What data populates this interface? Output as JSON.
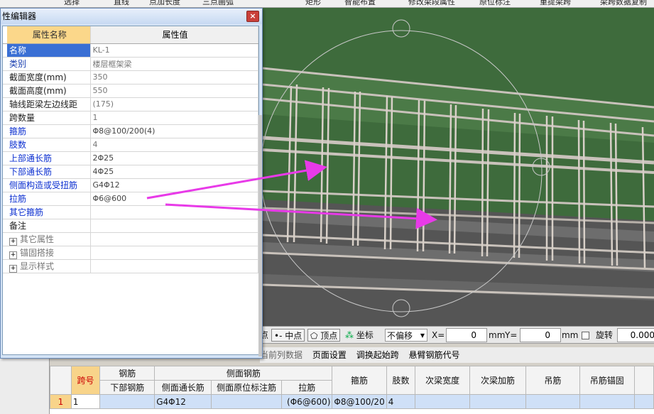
{
  "toolbar": {
    "items": [
      "选择",
      "直线",
      "点加长度",
      "三点画弧",
      "矩形",
      "智能布置",
      "修改梁段属性",
      "原位标注",
      "重提梁跨",
      "梁跨数据复制"
    ]
  },
  "dialog": {
    "title": "性编辑器",
    "close": "×",
    "header": {
      "name": "属性名称",
      "value": "属性值"
    },
    "rows": [
      {
        "name": "名称",
        "value": "KL-1"
      },
      {
        "name": "类别",
        "value": "楼层框架梁"
      },
      {
        "name": "截面宽度(mm)",
        "value": "350"
      },
      {
        "name": "截面高度(mm)",
        "value": "550"
      },
      {
        "name": "轴线距梁左边线距",
        "value": "(175)"
      },
      {
        "name": "跨数量",
        "value": "1"
      },
      {
        "name": "箍筋",
        "value": "Φ8@100/200(4)"
      },
      {
        "name": "肢数",
        "value": "4"
      },
      {
        "name": "上部通长筋",
        "value": "2Φ25"
      },
      {
        "name": "下部通长筋",
        "value": "4Φ25"
      },
      {
        "name": "侧面构造或受扭筋",
        "value": "G4Φ12"
      },
      {
        "name": "拉筋",
        "value": "Φ6@600"
      },
      {
        "name": "其它箍筋",
        "value": ""
      },
      {
        "name": "备注",
        "value": ""
      },
      {
        "name": "其它属性",
        "value": "",
        "expand": "+"
      },
      {
        "name": "锚固搭接",
        "value": "",
        "expand": "+"
      },
      {
        "name": "显示样式",
        "value": "",
        "expand": "+"
      }
    ]
  },
  "snapbar": {
    "dian": "点",
    "zhongdian": "中点",
    "dingdian": "顶点",
    "zuobiao": "坐标",
    "pianyi": "不偏移",
    "x_label": "X=",
    "x_value": "0",
    "mm1": "mm",
    "y_label": "Y=",
    "y_value": "0",
    "mm2": "mm",
    "xuanzhuan": "旋转",
    "angle": "0.000"
  },
  "menu2": {
    "items": [
      "当前列数据",
      "页面设置",
      "调换起始跨",
      "悬臂钢筋代号"
    ]
  },
  "grid": {
    "header_top": {
      "gangjin": "钢筋",
      "cemian": "侧面钢筋"
    },
    "headers": {
      "kuahao": "跨号",
      "xiabu": "下部钢筋",
      "cemian_tongchang": "侧面通长筋",
      "cemian_yuanwei": "侧面原位标注筋",
      "lajin": "拉筋",
      "gujin": "箍筋",
      "zhishu": "肢数",
      "ciliang_kuan": "次梁宽度",
      "ciliang_jia": "次梁加筋",
      "diaojin": "吊筋",
      "diaojin_mao": "吊筋锚固"
    },
    "row": {
      "rownum": "1",
      "kuahao": "1",
      "xiabu": "",
      "cemian_tongchang": "G4Φ12",
      "cemian_yuanwei": "",
      "lajin": "(Φ6@600)",
      "gujin": "Φ8@100/20",
      "zhishu": "4"
    }
  },
  "colors": {
    "annotation_arrow": "#e83ae8",
    "viewport_green": "#3d6a3d"
  }
}
